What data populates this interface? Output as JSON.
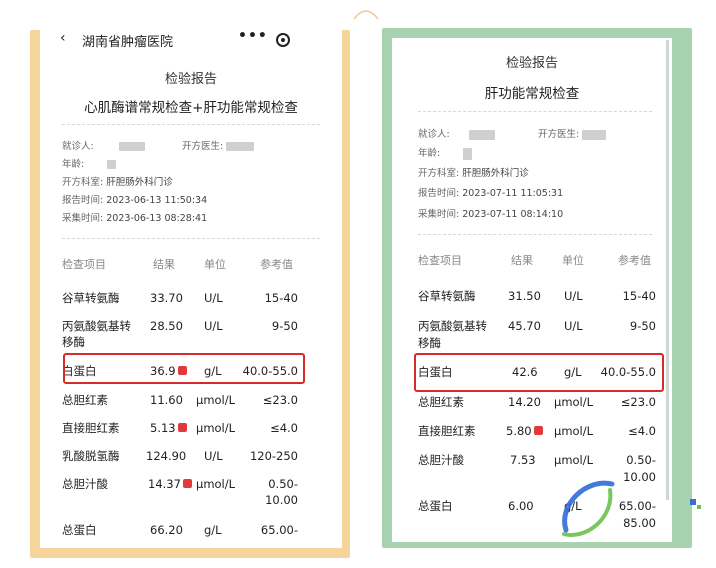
{
  "left": {
    "hospital": "湖南省肿瘤医院",
    "report_title": "检验报告",
    "subtitle": "心肌酶谱常规检查+肝功能常规检查",
    "labels": {
      "patient": "就诊人:",
      "doctor": "开方医生:",
      "age": "年龄:",
      "dept": "开方科室:",
      "report_time": "报告时间:",
      "collect_time": "采集时间:"
    },
    "dept": "肝胆肠外科门诊",
    "report_time": "2023-06-13 11:50:34",
    "collect_time": "2023-06-13 08:28:41",
    "headers": [
      "检查项目",
      "结果",
      "单位",
      "参考值"
    ],
    "rows": [
      {
        "name": "谷草转氨酶",
        "result": "33.70",
        "unit": "U/L",
        "ref": "15-40",
        "flag": false
      },
      {
        "name": "丙氨酸氨基转",
        "name2": "移酶",
        "result": "28.50",
        "unit": "U/L",
        "ref": "9-50",
        "flag": false
      },
      {
        "name": "白蛋白",
        "result": "36.9",
        "unit": "g/L",
        "ref": "40.0-55.0",
        "flag": true
      },
      {
        "name": "总胆红素",
        "result": "11.60",
        "unit": "μmol/L",
        "ref": "≤23.0",
        "flag": false
      },
      {
        "name": "直接胆红素",
        "result": "5.13",
        "unit": "μmol/L",
        "ref": "≤4.0",
        "flag": true
      },
      {
        "name": "乳酸脱氢酶",
        "result": "124.90",
        "unit": "U/L",
        "ref": "120-250",
        "flag": false
      },
      {
        "name": "总胆汁酸",
        "result": "14.37",
        "unit": "μmol/L",
        "ref": "0.50-",
        "ref2": "10.00",
        "flag": true
      },
      {
        "name": "总蛋白",
        "result": "66.20",
        "unit": "g/L",
        "ref": "65.00-",
        "flag": false
      }
    ]
  },
  "right": {
    "report_title": "检验报告",
    "subtitle": "肝功能常规检查",
    "labels": {
      "patient": "就诊人:",
      "doctor": "开方医生:",
      "age": "年龄:",
      "dept": "开方科室:",
      "report_time": "报告时间:",
      "collect_time": "采集时间:"
    },
    "dept": "肝胆肠外科门诊",
    "report_time": "2023-07-11 11:05:31",
    "collect_time": "2023-07-11 08:14:10",
    "headers": [
      "检查项目",
      "结果",
      "单位",
      "参考值"
    ],
    "rows": [
      {
        "name": "谷草转氨酶",
        "result": "31.50",
        "unit": "U/L",
        "ref": "15-40",
        "flag": false
      },
      {
        "name": "丙氨酸氨基转",
        "name2": "移酶",
        "result": "45.70",
        "unit": "U/L",
        "ref": "9-50",
        "flag": false
      },
      {
        "name": "白蛋白",
        "result": "42.6",
        "unit": "g/L",
        "ref": "40.0-55.0",
        "flag": false
      },
      {
        "name": "总胆红素",
        "result": "14.20",
        "unit": "μmol/L",
        "ref": "≤23.0",
        "flag": false
      },
      {
        "name": "直接胆红素",
        "result": "5.80",
        "unit": "μmol/L",
        "ref": "≤4.0",
        "flag": true
      },
      {
        "name": "总胆汁酸",
        "result": "7.53",
        "unit": "μmol/L",
        "ref": "0.50-",
        "ref2": "10.00",
        "flag": false
      },
      {
        "name": "总蛋白",
        "result": "6.00",
        "unit": "g/L",
        "ref": "65.00-",
        "ref2": "85.00",
        "flag": false
      }
    ]
  },
  "icons": {
    "back": "‹",
    "more": "•••"
  },
  "colors": {
    "left_frame": "#f6d59b",
    "right_frame": "#a8d3b0",
    "highlight": "#d62b2b",
    "flag": "#e23a3a"
  }
}
